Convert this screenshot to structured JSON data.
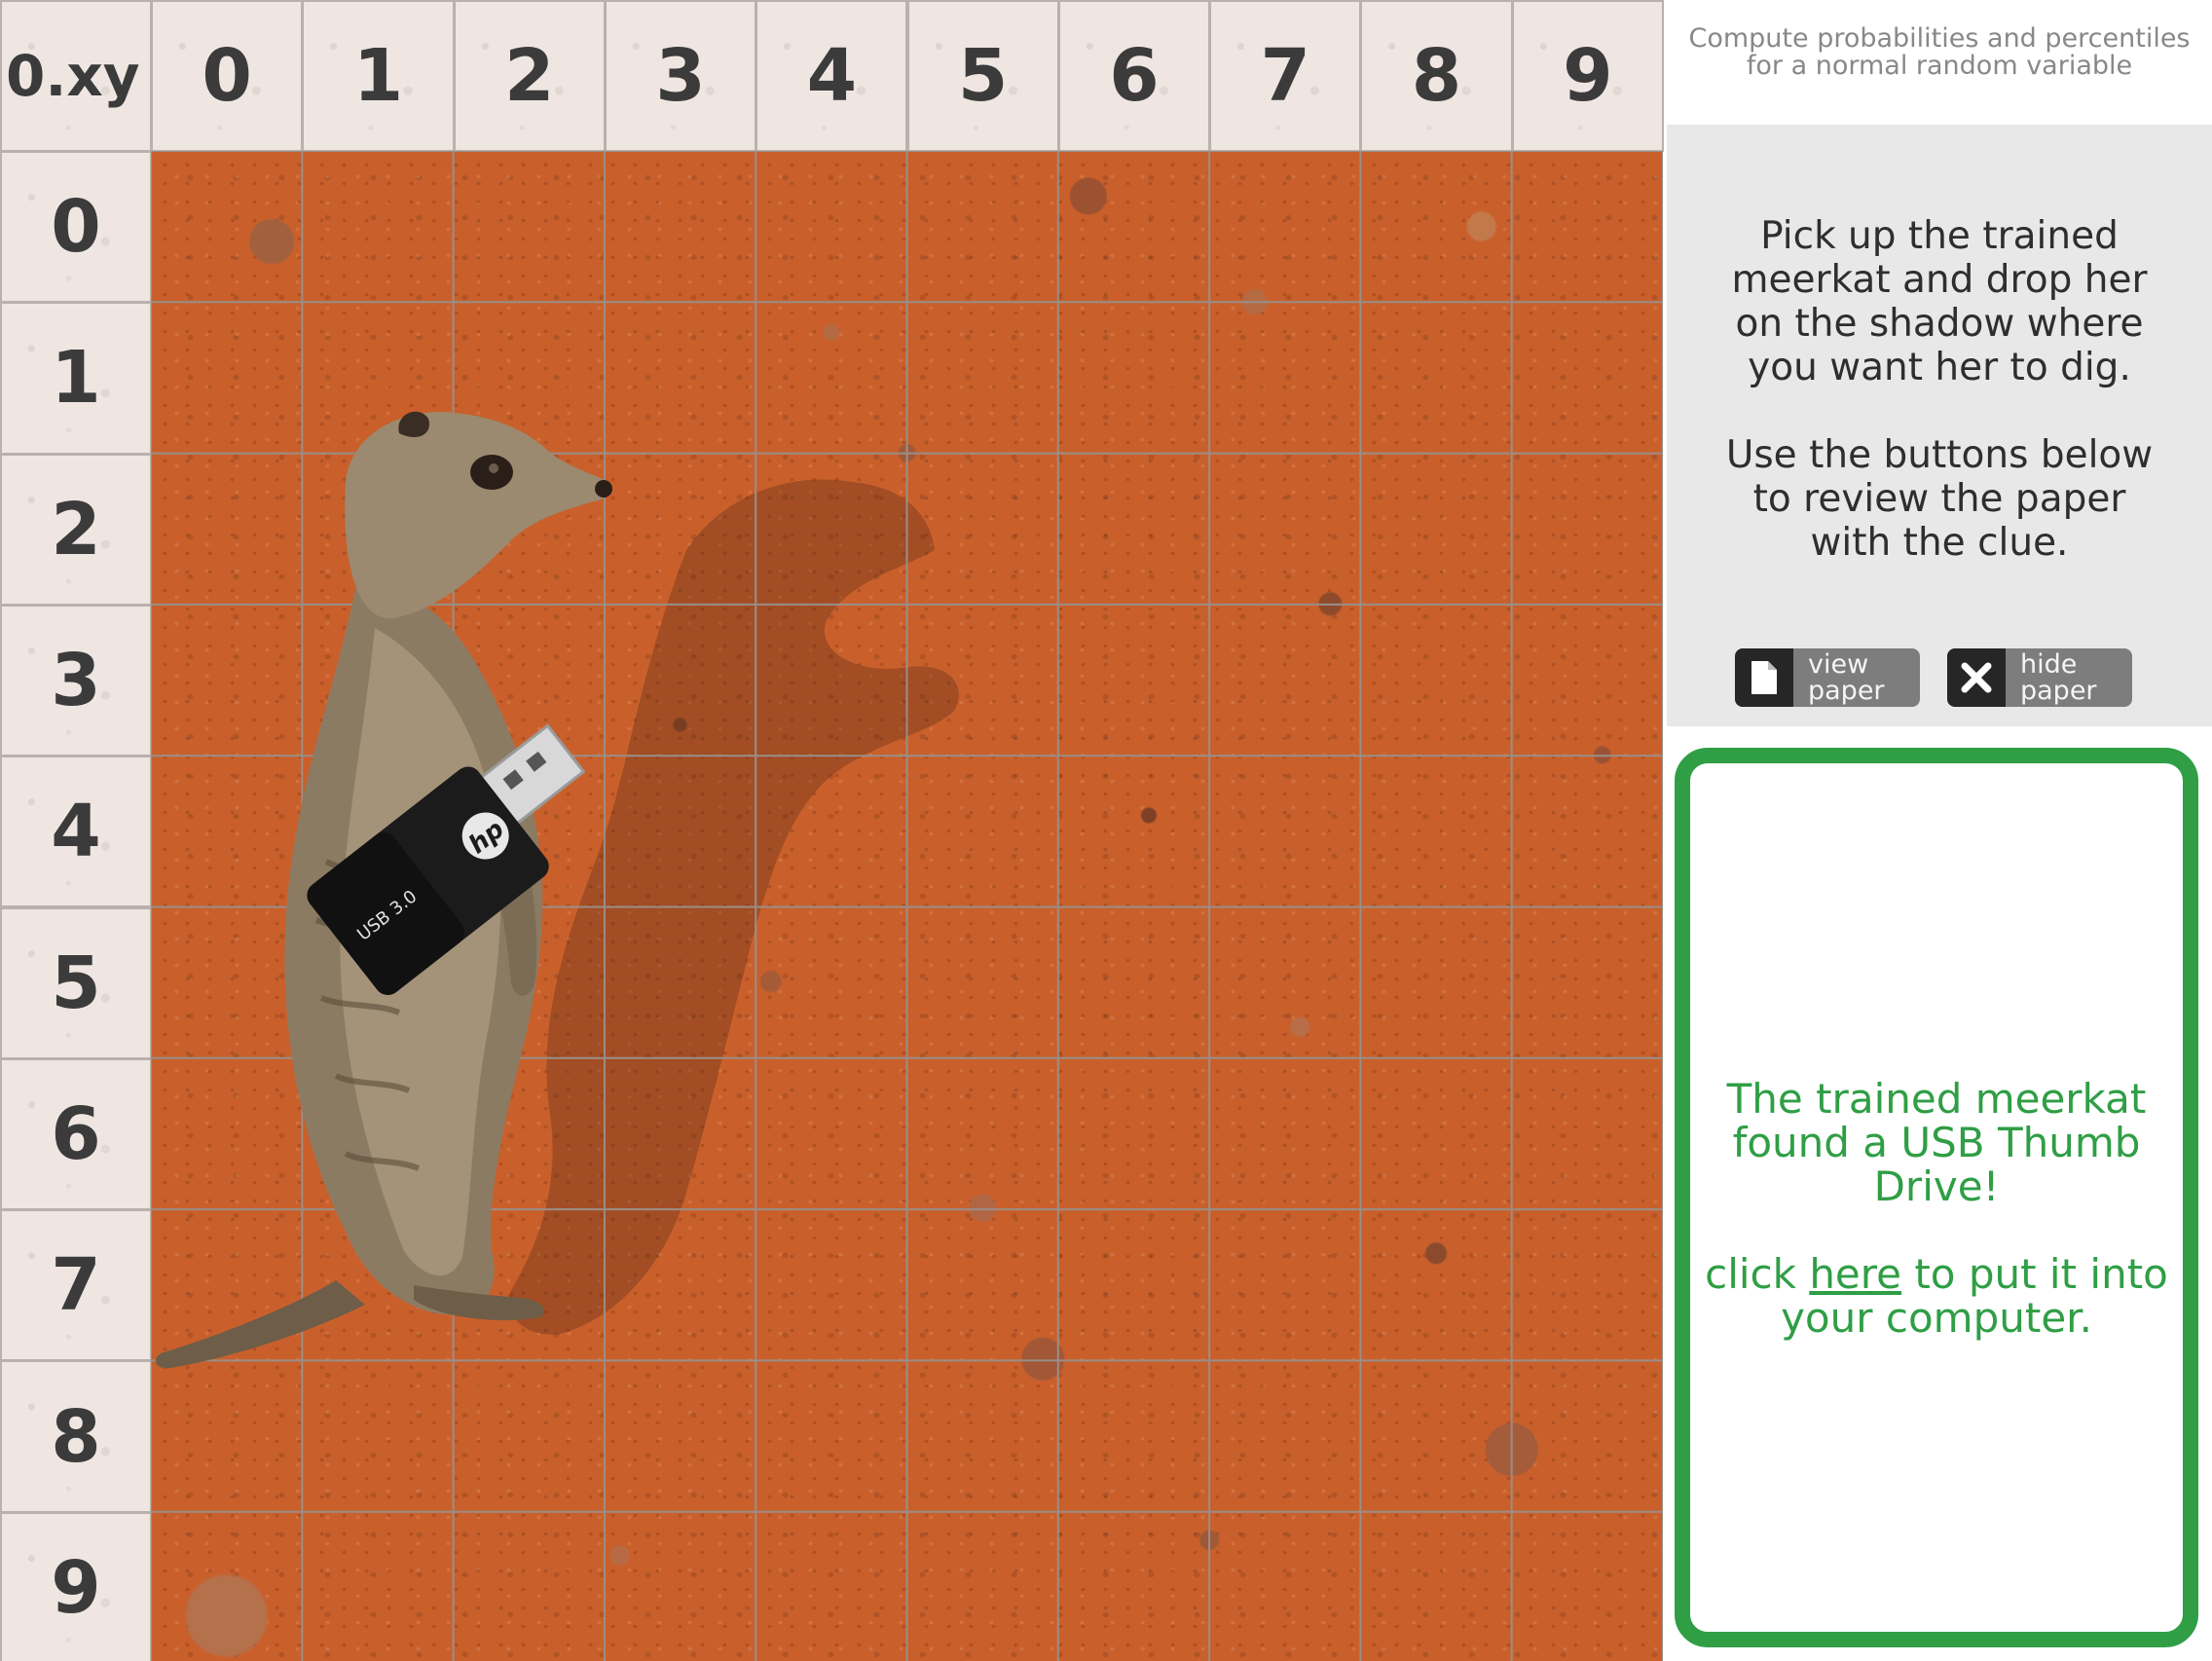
{
  "grid": {
    "corner_label": "0.xy",
    "column_headers": [
      "0",
      "1",
      "2",
      "3",
      "4",
      "5",
      "6",
      "7",
      "8",
      "9"
    ],
    "row_headers": [
      "0",
      "1",
      "2",
      "3",
      "4",
      "5",
      "6",
      "7",
      "8",
      "9"
    ]
  },
  "meerkat": {
    "item_text": "USB 3.0",
    "brand_logo": "hp"
  },
  "sidebar": {
    "subtitle": "Compute probabilities and percentiles\nfor a normal random variable",
    "instructions": "Pick up the trained\nmeerkat and drop her\non the shadow where\nyou want her to dig.\n\nUse the buttons below\nto review the paper\nwith the clue.",
    "view_paper_label": "view\npaper",
    "view_paper_icon": "document-icon",
    "hide_paper_label": "hide\npaper",
    "hide_paper_icon": "close-icon"
  },
  "result": {
    "message": "The trained meerkat\nfound a USB Thumb\nDrive!",
    "link_prefix": "click ",
    "link_text": "here",
    "link_suffix_line1": " to put it into",
    "link_suffix_line2": "your computer.",
    "color": "#2f9e45"
  },
  "colors": {
    "header_bg": "#efe6e2",
    "desert": "#c9602c",
    "instructions_bg": "#e8e8e8",
    "button_bg": "#7d7d7d",
    "button_icon_bg": "#262626"
  }
}
